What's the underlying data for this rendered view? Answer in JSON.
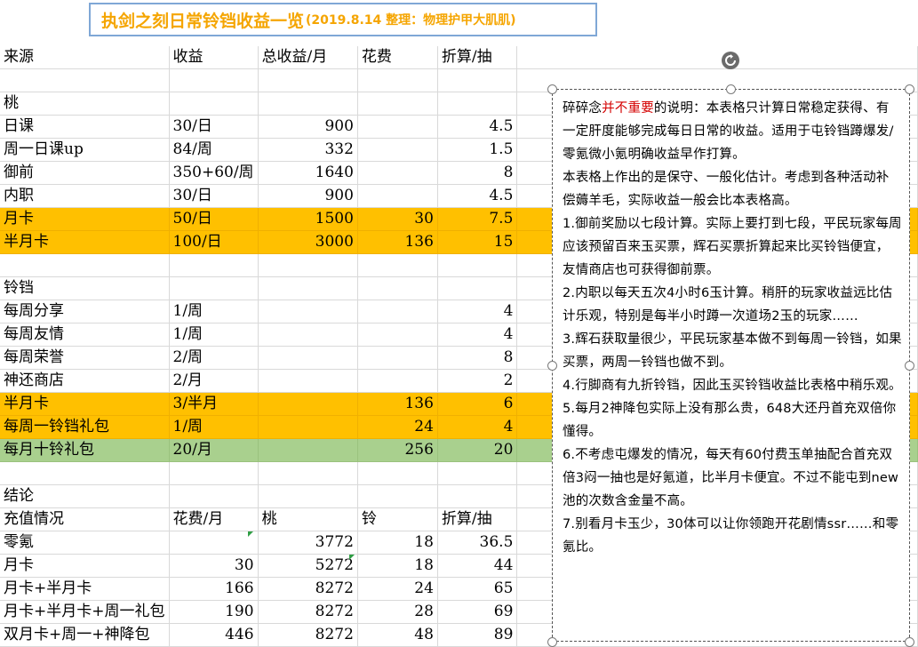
{
  "title": {
    "main": "执剑之刻日常铃铛收益一览",
    "sub": "(2019.8.14  整理：物理护甲大肌肌)",
    "color": "#f5a500"
  },
  "header": [
    "来源",
    "收益",
    "总收益/月",
    "花费",
    "折算/抽"
  ],
  "sections": {
    "peach": {
      "label": "桃",
      "rows": [
        {
          "c": [
            "日课",
            "30/日",
            "900",
            "",
            "4.5"
          ]
        },
        {
          "c": [
            "周一日课up",
            "84/周",
            "332",
            "",
            "1.5"
          ]
        },
        {
          "c": [
            "御前",
            "350+60/周",
            "1640",
            "",
            "8"
          ]
        },
        {
          "c": [
            "内职",
            "30/日",
            "900",
            "",
            "4.5"
          ]
        },
        {
          "c": [
            "月卡",
            "50/日",
            "1500",
            "30",
            "7.5"
          ],
          "hl": "orange"
        },
        {
          "c": [
            "半月卡",
            "100/日",
            "3000",
            "136",
            "15"
          ],
          "hl": "orange"
        }
      ]
    },
    "bell": {
      "label": "铃铛",
      "rows": [
        {
          "c": [
            "每周分享",
            "1/周",
            "",
            "",
            "4"
          ]
        },
        {
          "c": [
            "每周友情",
            "1/周",
            "",
            "",
            "4"
          ]
        },
        {
          "c": [
            "每周荣誉",
            "2/周",
            "",
            "",
            "8"
          ]
        },
        {
          "c": [
            "神还商店",
            "2/月",
            "",
            "",
            "2"
          ]
        },
        {
          "c": [
            "半月卡",
            "3/半月",
            "",
            "136",
            "6"
          ],
          "hl": "orange"
        },
        {
          "c": [
            "每周一铃铛礼包",
            "1/周",
            "",
            "24",
            "4"
          ],
          "hl": "orange"
        },
        {
          "c": [
            "每月十铃礼包",
            "20/月",
            "",
            "256",
            "20"
          ],
          "hl": "green"
        }
      ]
    },
    "conclusion": {
      "label": "结论",
      "header": [
        "充值情况",
        "花费/月",
        "桃",
        "铃",
        "折算/抽"
      ],
      "rows": [
        {
          "c": [
            "零氪",
            "",
            "3772",
            "18",
            "36.5"
          ]
        },
        {
          "c": [
            "月卡",
            "30",
            "5272",
            "18",
            "44"
          ]
        },
        {
          "c": [
            "月卡+半月卡",
            "166",
            "8272",
            "24",
            "65"
          ]
        },
        {
          "c": [
            "月卡+半月卡+周一礼包",
            "190",
            "8272",
            "28",
            "69"
          ]
        },
        {
          "c": [
            "双月卡+周一+神降包",
            "446",
            "8272",
            "48",
            "89"
          ]
        }
      ]
    }
  },
  "colors": {
    "highlight_orange": "#ffc000",
    "highlight_green": "#a9d08e",
    "note_red": "#d40000"
  },
  "note": {
    "p1_pre": "碎碎念",
    "p1_red": "并不重要",
    "p1_post": "的说明：本表格只计算日常稳定获得、有一定肝度能够完成每日日常的收益。适用于屯铃铛蹲爆发/零氪微小氪明确收益早作打算。",
    "p2": "本表格上作出的是保守、一般化估计。考虑到各种活动补偿薅羊毛，实际收益一般会比本表格高。",
    "p3": "1.御前奖励以七段计算。实际上要打到七段，平民玩家每周应该预留百来玉买票，辉石买票折算起来比买铃铛便宜，友情商店也可获得御前票。",
    "p4": "2.内职以每天五次4小时6玉计算。稍肝的玩家收益远比估计乐观，特别是每半小时蹲一次道场2玉的玩家……",
    "p5": "3.辉石获取量很少，平民玩家基本做不到每周一铃铛，如果买票，两周一铃铛也做不到。",
    "p6": "4.行脚商有九折铃铛，因此玉买铃铛收益比表格中稍乐观。",
    "p7": "5.每月2神降包实际上没有那么贵，648大还丹首充双倍你懂得。",
    "p8": "6.不考虑屯爆发的情况，每天有60付费玉单抽配合首充双倍3闷一抽也是好氪道，比半月卡便宜。不过不能屯到new池的次数含金量不高。",
    "p9": "7.别看月卡玉少，30体可以让你领跑开花剧情ssr……和零氪比。"
  }
}
